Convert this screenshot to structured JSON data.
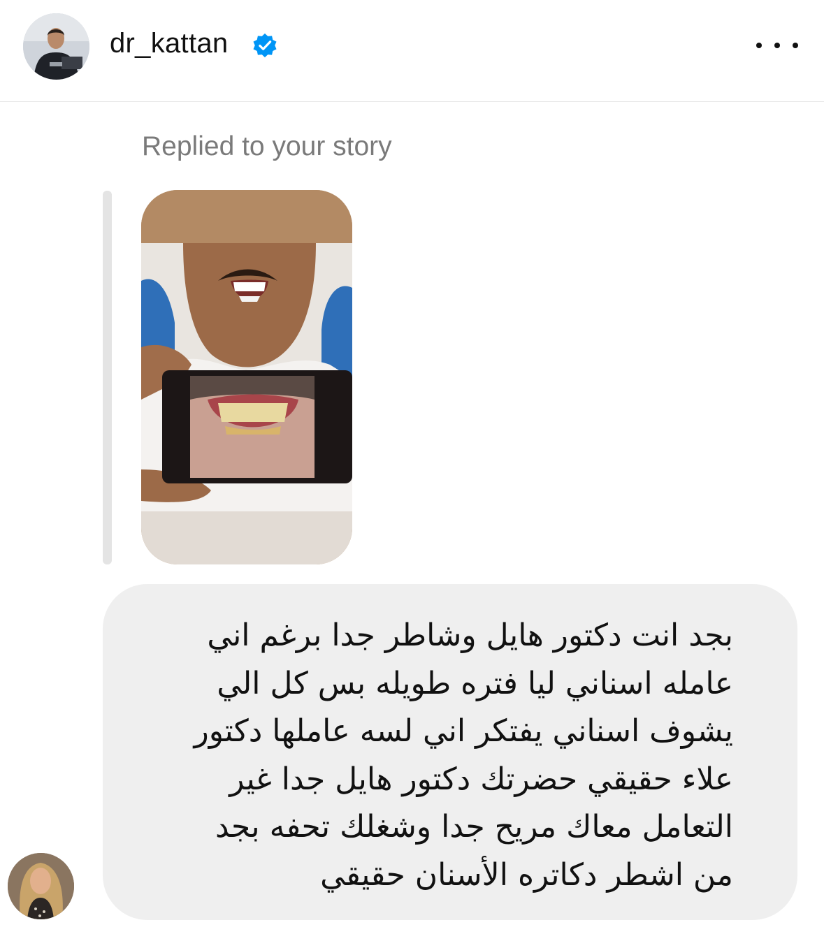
{
  "header": {
    "username": "dr_kattan",
    "verified_icon": "verified-badge-icon",
    "more_icon": "more-options-icon"
  },
  "reply": {
    "label": "Replied to your story"
  },
  "message": {
    "lines": [
      "بجد انت دكتور هايل وشاطر جدا برغم اني",
      "عامله اسناني ليا فتره طويله بس كل الي",
      "يشوف اسناني يفتكر اني لسه عاملها دكتور",
      "علاء حقيقي حضرتك  دكتور هايل جدا غير",
      "التعامل معاك مريح جدا وشغلك تحفه بجد",
      "من اشطر دكاتره الأسنان حقيقي"
    ]
  },
  "colors": {
    "verified_blue": "#0095f6",
    "bubble_bg": "#efefef",
    "muted_text": "#7a7a7a"
  }
}
